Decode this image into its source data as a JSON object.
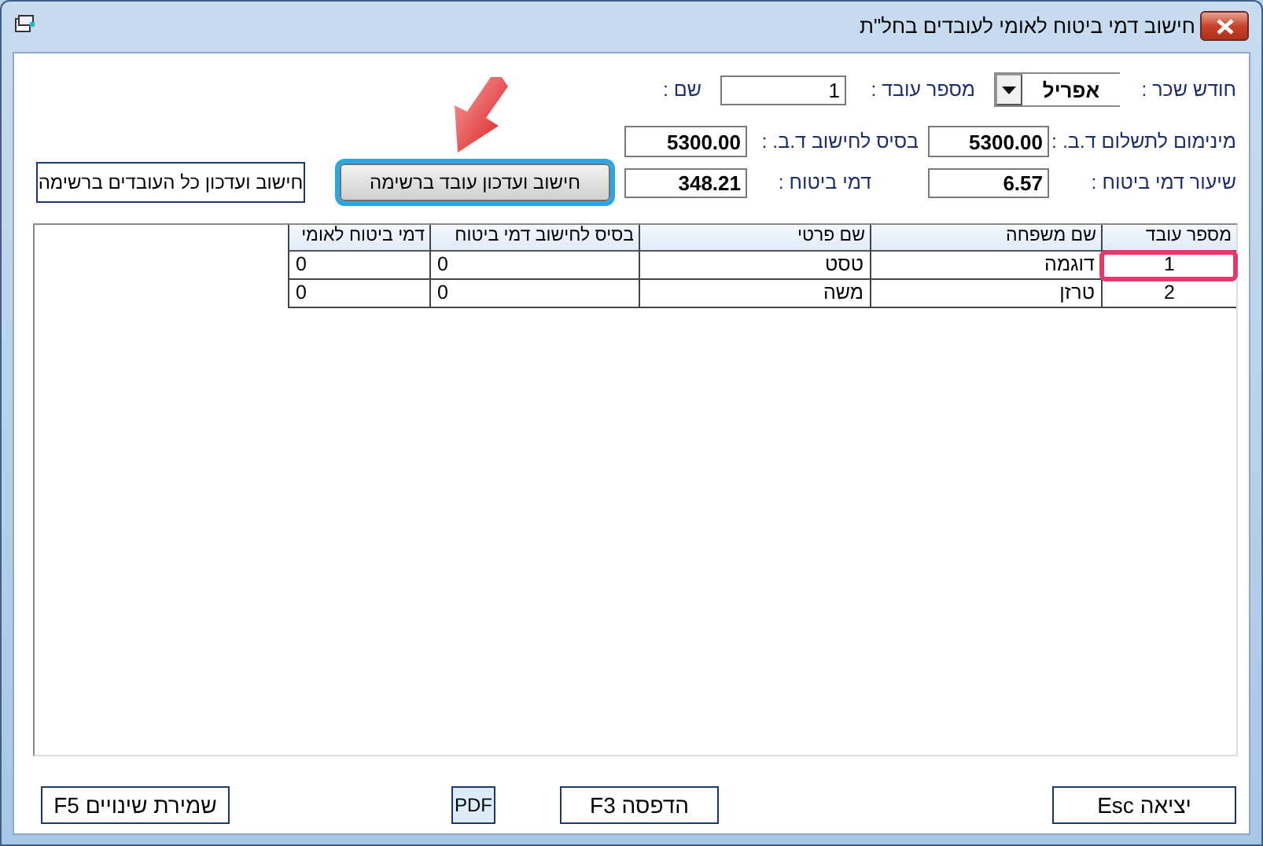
{
  "window": {
    "title": "חישוב דמי ביטוח לאומי לעובדים בחל\"ת"
  },
  "form": {
    "month": {
      "label": "חודש שכר :",
      "value": "אפריל"
    },
    "employee_number": {
      "label": "מספר עובד :",
      "value": "1"
    },
    "name": {
      "label": "שם :"
    },
    "min_payment": {
      "label": "מינימום לתשלום ד.ב. :",
      "value": "5300.00"
    },
    "base": {
      "label": "בסיס לחישוב ד.ב. :",
      "value": "5300.00"
    },
    "rate": {
      "label": "שיעור דמי ביטוח :",
      "value": "6.57"
    },
    "premium": {
      "label": "דמי ביטוח :",
      "value": "348.21"
    }
  },
  "actions": [
    {
      "label": "חישוב ועדכון עובד ברשימה",
      "kind": "raised",
      "highlighted": true,
      "pointed_at": true
    },
    {
      "label": "חישוב ועדכון כל העובדים ברשימה",
      "kind": "flat",
      "highlighted": false,
      "pointed_at": false
    }
  ],
  "table": {
    "columns": [
      "מספר עובד",
      "שם משפחה",
      "שם פרטי",
      "בסיס לחישוב דמי ביטוח",
      "דמי ביטוח לאומי"
    ],
    "rows": [
      {
        "cells": [
          "1",
          "דוגמה",
          "טסט",
          "0",
          "0"
        ],
        "highlighted": true
      },
      {
        "cells": [
          "2",
          "טרזן",
          "משה",
          "0",
          "0"
        ],
        "highlighted": false
      }
    ]
  },
  "footer_buttons": [
    {
      "label": "יציאה Esc",
      "kind": "plain"
    },
    {
      "label": "הדפסה F3",
      "kind": "plain"
    },
    {
      "label": "PDF",
      "kind": "pdf"
    },
    {
      "label": "שמירת שינויים F5",
      "kind": "plain"
    }
  ]
}
